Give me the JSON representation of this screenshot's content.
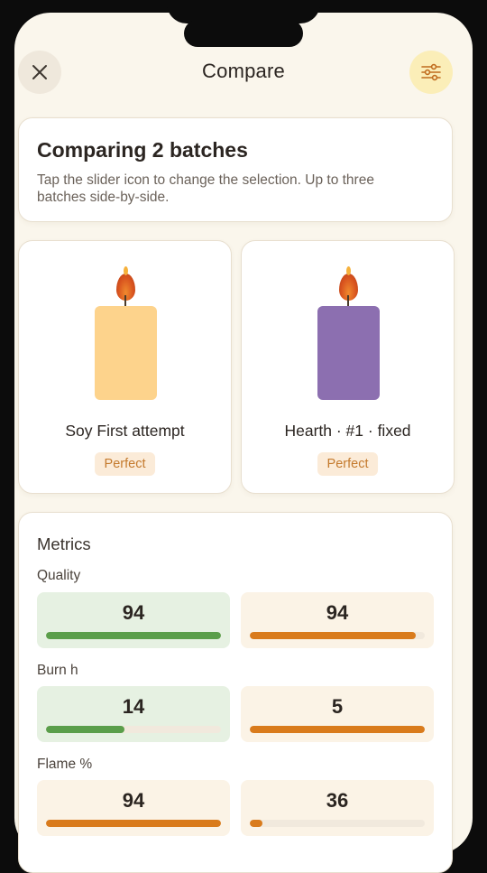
{
  "header": {
    "title": "Compare",
    "close_icon": "close-icon",
    "filter_icon": "sliders-icon"
  },
  "intro": {
    "title": "Comparing 2 batches",
    "description": "Tap the slider icon to change the selection. Up to three batches side-by-side."
  },
  "batches": [
    {
      "name": "Soy First attempt",
      "status": "Perfect",
      "candle_color": "#fdd38c"
    },
    {
      "name": "Hearth · #1 · fixed",
      "status": "Perfect",
      "candle_color": "#8c6fb0"
    }
  ],
  "metrics": {
    "title": "Metrics",
    "rows": [
      {
        "label": "Quality",
        "values": [
          "94",
          "94"
        ],
        "fractions": [
          1.0,
          0.95
        ],
        "winner": [
          true,
          false
        ]
      },
      {
        "label": "Burn h",
        "values": [
          "14",
          "5"
        ],
        "fractions": [
          0.45,
          1.0
        ],
        "winner": [
          true,
          false
        ]
      },
      {
        "label": "Flame %",
        "values": [
          "94",
          "36"
        ],
        "fractions": [
          1.0,
          0.07
        ],
        "winner": [
          false,
          false
        ]
      }
    ]
  },
  "colors": {
    "accent": "#d97b1c",
    "win": "#5a9e4a",
    "background": "#faf6ec"
  }
}
